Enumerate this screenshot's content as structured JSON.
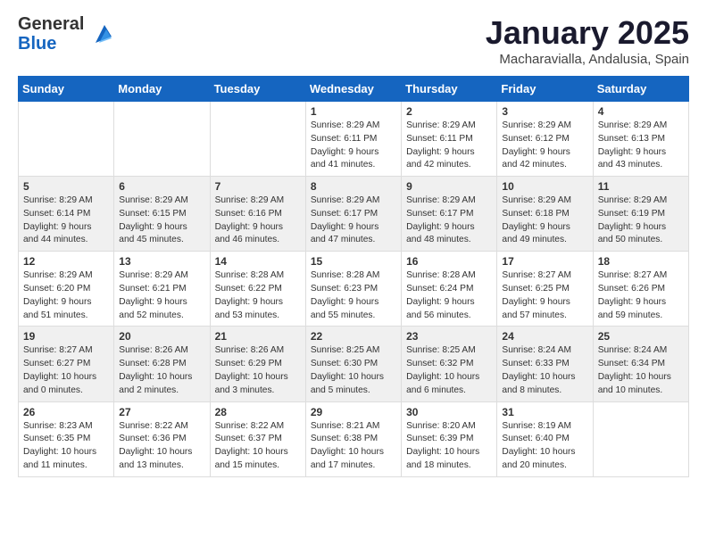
{
  "header": {
    "logo_line1": "General",
    "logo_line2": "Blue",
    "title": "January 2025",
    "subtitle": "Macharavialla, Andalusia, Spain"
  },
  "weekdays": [
    "Sunday",
    "Monday",
    "Tuesday",
    "Wednesday",
    "Thursday",
    "Friday",
    "Saturday"
  ],
  "weeks": [
    [
      {
        "day": "",
        "info": ""
      },
      {
        "day": "",
        "info": ""
      },
      {
        "day": "",
        "info": ""
      },
      {
        "day": "1",
        "info": "Sunrise: 8:29 AM\nSunset: 6:11 PM\nDaylight: 9 hours\nand 41 minutes."
      },
      {
        "day": "2",
        "info": "Sunrise: 8:29 AM\nSunset: 6:11 PM\nDaylight: 9 hours\nand 42 minutes."
      },
      {
        "day": "3",
        "info": "Sunrise: 8:29 AM\nSunset: 6:12 PM\nDaylight: 9 hours\nand 42 minutes."
      },
      {
        "day": "4",
        "info": "Sunrise: 8:29 AM\nSunset: 6:13 PM\nDaylight: 9 hours\nand 43 minutes."
      }
    ],
    [
      {
        "day": "5",
        "info": "Sunrise: 8:29 AM\nSunset: 6:14 PM\nDaylight: 9 hours\nand 44 minutes."
      },
      {
        "day": "6",
        "info": "Sunrise: 8:29 AM\nSunset: 6:15 PM\nDaylight: 9 hours\nand 45 minutes."
      },
      {
        "day": "7",
        "info": "Sunrise: 8:29 AM\nSunset: 6:16 PM\nDaylight: 9 hours\nand 46 minutes."
      },
      {
        "day": "8",
        "info": "Sunrise: 8:29 AM\nSunset: 6:17 PM\nDaylight: 9 hours\nand 47 minutes."
      },
      {
        "day": "9",
        "info": "Sunrise: 8:29 AM\nSunset: 6:17 PM\nDaylight: 9 hours\nand 48 minutes."
      },
      {
        "day": "10",
        "info": "Sunrise: 8:29 AM\nSunset: 6:18 PM\nDaylight: 9 hours\nand 49 minutes."
      },
      {
        "day": "11",
        "info": "Sunrise: 8:29 AM\nSunset: 6:19 PM\nDaylight: 9 hours\nand 50 minutes."
      }
    ],
    [
      {
        "day": "12",
        "info": "Sunrise: 8:29 AM\nSunset: 6:20 PM\nDaylight: 9 hours\nand 51 minutes."
      },
      {
        "day": "13",
        "info": "Sunrise: 8:29 AM\nSunset: 6:21 PM\nDaylight: 9 hours\nand 52 minutes."
      },
      {
        "day": "14",
        "info": "Sunrise: 8:28 AM\nSunset: 6:22 PM\nDaylight: 9 hours\nand 53 minutes."
      },
      {
        "day": "15",
        "info": "Sunrise: 8:28 AM\nSunset: 6:23 PM\nDaylight: 9 hours\nand 55 minutes."
      },
      {
        "day": "16",
        "info": "Sunrise: 8:28 AM\nSunset: 6:24 PM\nDaylight: 9 hours\nand 56 minutes."
      },
      {
        "day": "17",
        "info": "Sunrise: 8:27 AM\nSunset: 6:25 PM\nDaylight: 9 hours\nand 57 minutes."
      },
      {
        "day": "18",
        "info": "Sunrise: 8:27 AM\nSunset: 6:26 PM\nDaylight: 9 hours\nand 59 minutes."
      }
    ],
    [
      {
        "day": "19",
        "info": "Sunrise: 8:27 AM\nSunset: 6:27 PM\nDaylight: 10 hours\nand 0 minutes."
      },
      {
        "day": "20",
        "info": "Sunrise: 8:26 AM\nSunset: 6:28 PM\nDaylight: 10 hours\nand 2 minutes."
      },
      {
        "day": "21",
        "info": "Sunrise: 8:26 AM\nSunset: 6:29 PM\nDaylight: 10 hours\nand 3 minutes."
      },
      {
        "day": "22",
        "info": "Sunrise: 8:25 AM\nSunset: 6:30 PM\nDaylight: 10 hours\nand 5 minutes."
      },
      {
        "day": "23",
        "info": "Sunrise: 8:25 AM\nSunset: 6:32 PM\nDaylight: 10 hours\nand 6 minutes."
      },
      {
        "day": "24",
        "info": "Sunrise: 8:24 AM\nSunset: 6:33 PM\nDaylight: 10 hours\nand 8 minutes."
      },
      {
        "day": "25",
        "info": "Sunrise: 8:24 AM\nSunset: 6:34 PM\nDaylight: 10 hours\nand 10 minutes."
      }
    ],
    [
      {
        "day": "26",
        "info": "Sunrise: 8:23 AM\nSunset: 6:35 PM\nDaylight: 10 hours\nand 11 minutes."
      },
      {
        "day": "27",
        "info": "Sunrise: 8:22 AM\nSunset: 6:36 PM\nDaylight: 10 hours\nand 13 minutes."
      },
      {
        "day": "28",
        "info": "Sunrise: 8:22 AM\nSunset: 6:37 PM\nDaylight: 10 hours\nand 15 minutes."
      },
      {
        "day": "29",
        "info": "Sunrise: 8:21 AM\nSunset: 6:38 PM\nDaylight: 10 hours\nand 17 minutes."
      },
      {
        "day": "30",
        "info": "Sunrise: 8:20 AM\nSunset: 6:39 PM\nDaylight: 10 hours\nand 18 minutes."
      },
      {
        "day": "31",
        "info": "Sunrise: 8:19 AM\nSunset: 6:40 PM\nDaylight: 10 hours\nand 20 minutes."
      },
      {
        "day": "",
        "info": ""
      }
    ]
  ]
}
